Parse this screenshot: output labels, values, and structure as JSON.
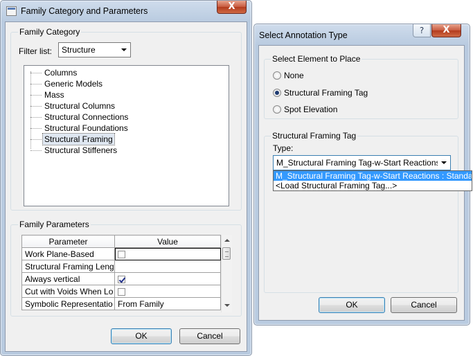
{
  "family_dialog": {
    "title": "Family Category and Parameters",
    "category_group": "Family Category",
    "filter_label": "Filter list:",
    "filter_value": "Structure",
    "categories": [
      "Columns",
      "Generic Models",
      "Mass",
      "Structural Columns",
      "Structural Connections",
      "Structural Foundations",
      "Structural Framing",
      "Structural Stiffeners"
    ],
    "selected_category": "Structural Framing",
    "params_group": "Family Parameters",
    "columns": [
      "Parameter",
      "Value"
    ],
    "params": [
      {
        "name": "Work Plane-Based",
        "value": "",
        "check": false
      },
      {
        "name": "Structural Framing Leng",
        "value": "",
        "check": null
      },
      {
        "name": "Always vertical",
        "value": "",
        "check": true
      },
      {
        "name": "Cut with Voids When Lo",
        "value": "",
        "check": false
      },
      {
        "name": "Symbolic Representatio",
        "value": "From Family",
        "check": null
      }
    ],
    "ok_label": "OK",
    "cancel_label": "Cancel",
    "close_glyph": "X"
  },
  "annotation_dialog": {
    "title": "Select Annotation Type",
    "help_glyph": "?",
    "close_glyph": "X",
    "place_group": "Select Element to Place",
    "options": [
      {
        "label": "None",
        "selected": false
      },
      {
        "label": "Structural Framing Tag",
        "selected": true
      },
      {
        "label": "Spot Elevation",
        "selected": false
      }
    ],
    "tag_group": "Structural Framing Tag",
    "type_label": "Type:",
    "type_value": "M_Structural Framing Tag-w-Start Reactions : St",
    "dropdown_items": [
      "M_Structural Framing Tag-w-Start Reactions : Standard",
      "<Load Structural Framing Tag...>"
    ],
    "ok_label": "OK",
    "cancel_label": "Cancel"
  },
  "colors": {
    "selection": "#3399ff",
    "close_button": "#c75a3e",
    "window_frame": "#b9cbe0"
  }
}
